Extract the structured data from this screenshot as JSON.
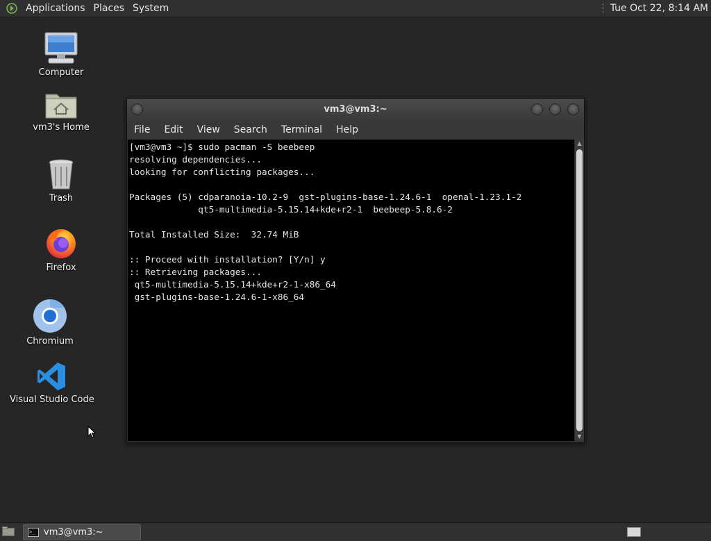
{
  "top_panel": {
    "menus": [
      "Applications",
      "Places",
      "System"
    ],
    "clock": "Tue Oct 22,  8:14 AM"
  },
  "desktop_icons": [
    {
      "label": "Computer",
      "icon": "computer-icon"
    },
    {
      "label": "vm3's Home",
      "icon": "home-folder-icon"
    },
    {
      "label": "Trash",
      "icon": "trash-icon"
    },
    {
      "label": "Firefox",
      "icon": "firefox-icon"
    },
    {
      "label": "Chromium",
      "icon": "chromium-icon"
    },
    {
      "label": "Visual Studio Code",
      "icon": "vscode-icon"
    }
  ],
  "terminal": {
    "title": "vm3@vm3:~",
    "menu": [
      "File",
      "Edit",
      "View",
      "Search",
      "Terminal",
      "Help"
    ],
    "output": "[vm3@vm3 ~]$ sudo pacman -S beebeep\nresolving dependencies...\nlooking for conflicting packages...\n\nPackages (5) cdparanoia-10.2-9  gst-plugins-base-1.24.6-1  openal-1.23.1-2\n             qt5-multimedia-5.15.14+kde+r2-1  beebeep-5.8.6-2\n\nTotal Installed Size:  32.74 MiB\n\n:: Proceed with installation? [Y/n] y\n:: Retrieving packages...\n qt5-multimedia-5.15.14+kde+r2-1-x86_64\n gst-plugins-base-1.24.6-1-x86_64"
  },
  "taskbar": {
    "task_label": "vm3@vm3:~",
    "task_icon_glyph": ">_"
  },
  "colors": {
    "desktop": "#262626",
    "panel": "#303030",
    "terminal_bg": "#000000",
    "terminal_fg": "#e6e6e6"
  }
}
